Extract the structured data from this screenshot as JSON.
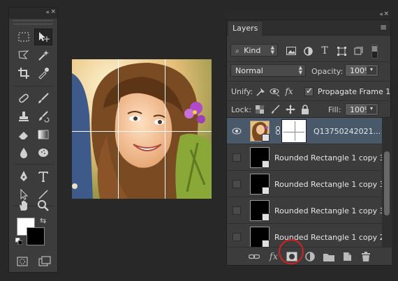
{
  "tools_panel": {
    "collapse_glyph": "«",
    "close_glyph": "×",
    "tools": [
      {
        "name": "rectangular-marquee-icon"
      },
      {
        "name": "move-icon",
        "active": true
      },
      {
        "name": "lasso-icon"
      },
      {
        "name": "magic-wand-icon"
      },
      {
        "name": "crop-icon"
      },
      {
        "name": "eyedropper-icon"
      },
      {
        "name": "spot-healing-icon"
      },
      {
        "name": "brush-icon"
      },
      {
        "name": "clone-stamp-icon"
      },
      {
        "name": "history-brush-icon"
      },
      {
        "name": "eraser-icon"
      },
      {
        "name": "gradient-icon"
      },
      {
        "name": "blur-icon"
      },
      {
        "name": "sponge-icon"
      },
      {
        "name": "pen-icon"
      },
      {
        "name": "type-icon"
      },
      {
        "name": "path-selection-icon"
      },
      {
        "name": "line-icon"
      },
      {
        "name": "hand-icon"
      },
      {
        "name": "zoom-icon"
      }
    ],
    "foreground_color": "#ffffff",
    "background_color": "#000000",
    "swap_glyph": "⇆"
  },
  "layers_panel": {
    "tab_label": "Layers",
    "menu_glyph": "≡",
    "filter": {
      "kind_label": "Kind"
    },
    "blend": {
      "mode_value": "Normal",
      "opacity_label": "Opacity:",
      "opacity_value": "100%"
    },
    "unify": {
      "label": "Unify:",
      "propagate_label": "Propagate Frame 1"
    },
    "lock": {
      "label": "Lock:",
      "fill_label": "Fill:",
      "fill_value": "100%"
    },
    "layers": [
      {
        "name": "Q13750242021...",
        "selected": true,
        "visible": true,
        "has_mask": true
      },
      {
        "name": "Rounded Rectangle 1 copy 3",
        "selected": false,
        "visible": false
      },
      {
        "name": "Rounded Rectangle 1 copy 3",
        "selected": false,
        "visible": false
      },
      {
        "name": "Rounded Rectangle 1 copy 3",
        "selected": false,
        "visible": false
      },
      {
        "name": "Rounded Rectangle 1 copy 2",
        "selected": false,
        "visible": false
      }
    ],
    "footer_icons": [
      "link-layers-icon",
      "fx-icon",
      "add-mask-icon",
      "adjustment-icon",
      "group-icon",
      "new-layer-icon",
      "trash-icon"
    ],
    "fx_label": "fx"
  },
  "colors": {
    "accent_highlight": "#d82020",
    "selected_layer": "#4a596a",
    "panel_bg": "#3c3c3c"
  }
}
